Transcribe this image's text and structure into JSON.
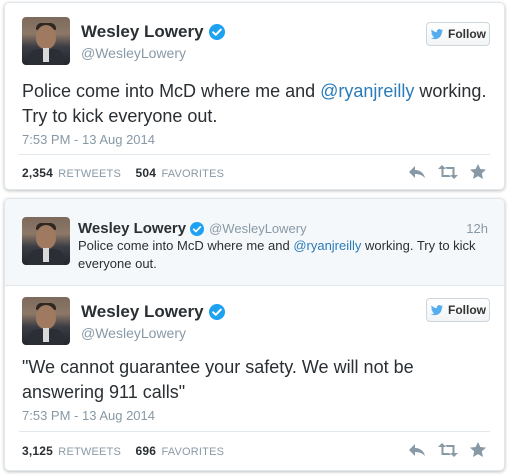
{
  "tweet1": {
    "name": "Wesley Lowery",
    "handle": "@WesleyLowery",
    "follow_label": "Follow",
    "text_before": "Police come into McD where me and ",
    "mention": "@ryanjreilly",
    "text_after": " working. Try to kick everyone out.",
    "timestamp": "7:53 PM - 13 Aug 2014",
    "retweets_count": "2,354",
    "retweets_label": "RETWEETS",
    "favorites_count": "504",
    "favorites_label": "FAVORITES"
  },
  "quoted": {
    "name": "Wesley Lowery",
    "handle": "@WesleyLowery",
    "relative_time": "12h",
    "text_before": "Police come into McD where me and ",
    "mention": "@ryanjreilly",
    "text_after": " working. Try to kick everyone out."
  },
  "tweet2": {
    "name": "Wesley Lowery",
    "handle": "@WesleyLowery",
    "follow_label": "Follow",
    "text": "\"We cannot guarantee your safety. We will not be answering 911 calls\"",
    "timestamp": "7:53 PM - 13 Aug 2014",
    "retweets_count": "3,125",
    "retweets_label": "RETWEETS",
    "favorites_count": "696",
    "favorites_label": "FAVORITES"
  },
  "icons": {
    "verified": "verified-badge-icon",
    "bird": "twitter-bird-icon",
    "reply": "reply-icon",
    "retweet": "retweet-icon",
    "favorite": "star-icon"
  },
  "colors": {
    "link": "#2b7bb9",
    "verified": "#1da1f2",
    "muted": "#8899a6",
    "text": "#292f33"
  }
}
